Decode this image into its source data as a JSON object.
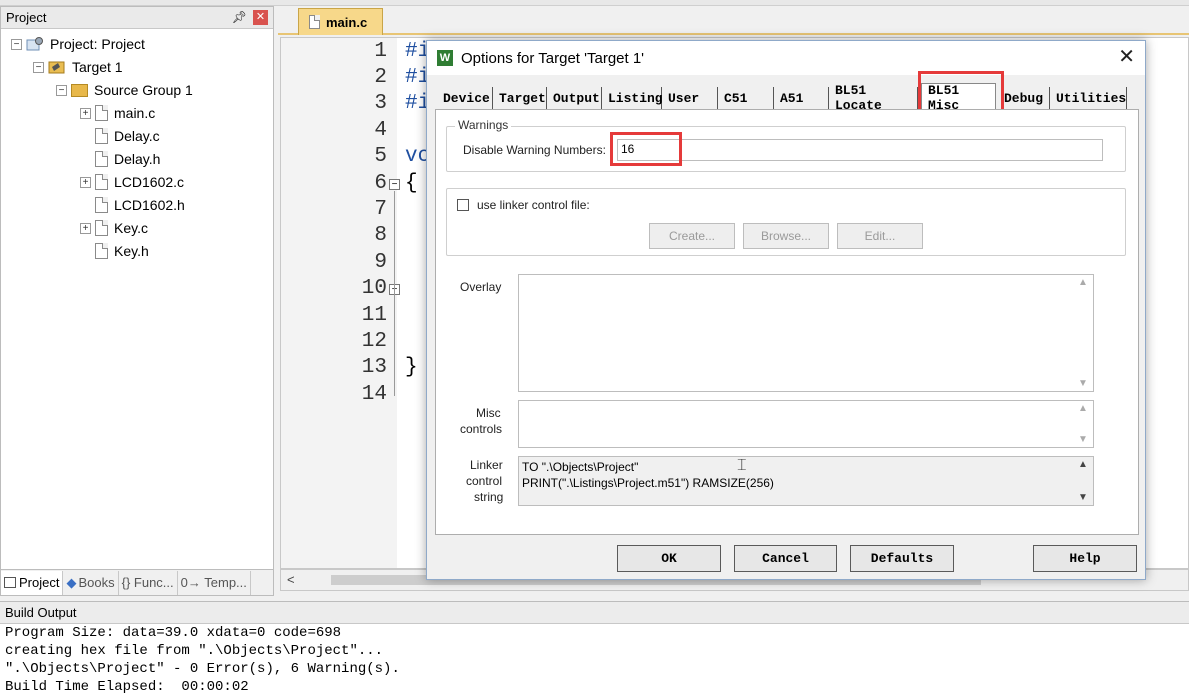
{
  "project_panel": {
    "title": "Project",
    "tree": {
      "project": "Project: Project",
      "target": "Target 1",
      "group": "Source Group 1",
      "files": [
        "main.c",
        "Delay.c",
        "Delay.h",
        "LCD1602.c",
        "LCD1602.h",
        "Key.c",
        "Key.h"
      ]
    },
    "bottom_tabs": [
      "Project",
      "Books",
      "{} Func...",
      "0→ Temp..."
    ]
  },
  "editor": {
    "tab_label": "main.c",
    "line_numbers": [
      "1",
      "2",
      "3",
      "4",
      "5",
      "6",
      "7",
      "8",
      "9",
      "10",
      "11",
      "12",
      "13",
      "14"
    ],
    "visible_code": {
      "line1": "#i",
      "line2": "#i",
      "line3": "#i",
      "line5": "vc",
      "line6": "{",
      "line13": "}"
    }
  },
  "build_output": {
    "title": "Build Output",
    "lines": [
      "Program Size: data=39.0 xdata=0 code=698",
      "creating hex file from \".\\Objects\\Project\"...",
      "\".\\Objects\\Project\" - 0 Error(s), 6 Warning(s).",
      "Build Time Elapsed:  00:00:02"
    ]
  },
  "dialog": {
    "title": "Options for Target 'Target 1'",
    "icon_letter": "W",
    "tabs": [
      "Device",
      "Target",
      "Output",
      "Listing",
      "User",
      "C51",
      "A51",
      "BL51 Locate",
      "BL51 Misc",
      "Debug",
      "Utilities"
    ],
    "active_tab": "BL51 Misc",
    "warnings_group": {
      "legend": "Warnings",
      "label": "Disable Warning Numbers:",
      "value": "16"
    },
    "linker_group": {
      "checkbox_label": "use linker control file:",
      "checked": false,
      "buttons": [
        "Create...",
        "Browse...",
        "Edit..."
      ]
    },
    "overlay_label": "Overlay",
    "misc_label_1": "Misc",
    "misc_label_2": "controls",
    "linker_string_label_1": "Linker",
    "linker_string_label_2": "control",
    "linker_string_label_3": "string",
    "linker_string_lines": [
      "TO \".\\Objects\\Project\"",
      "PRINT(\".\\Listings\\Project.m51\") RAMSIZE(256)"
    ],
    "buttons": {
      "ok": "OK",
      "cancel": "Cancel",
      "defaults": "Defaults",
      "help": "Help"
    },
    "highlight_color": "#e53a3a"
  }
}
